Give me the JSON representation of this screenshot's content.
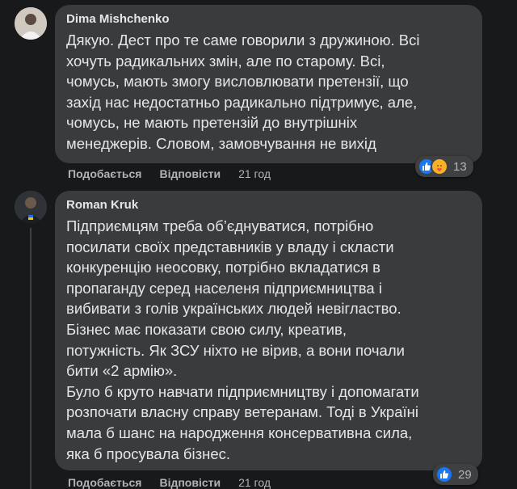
{
  "comments": [
    {
      "author": "Dima Mishchenko",
      "lines": [
        "Дякую. Дест про те саме говорили з дружиною. Всі",
        "хочуть радикальних змін, але по старому. Всі,",
        "чомусь, мають змогу висловлювати претензії, що",
        "захід нас недостатньо радикально підтримує, але,",
        "чомусь, не мають претензій до внутрішніх",
        "менеджерів. Словом, замовчування не вихід"
      ],
      "like_label": "Подобається",
      "reply_label": "Відповісти",
      "time": "21 год",
      "reaction_count": "13",
      "reactions": [
        "like-icon",
        "care-icon"
      ]
    },
    {
      "author": "Roman Kruk",
      "lines": [
        "Підприємцям треба об’єднуватися, потрібно",
        "посилати своїх представників у владу і скласти",
        "конкуренцію неосовку, потрібно вкладатися в",
        "пропаганду серед населеня підприємництва і",
        "вибивати з голів українських людей невігластво.",
        "Бізнес має показати свою силу, креатив,",
        "потужність. Як ЗСУ ніхто не вірив, а вони почали",
        "бити «2 армію».",
        "Було б круто навчати підприємництву і допомагати",
        "розпочати власну справу ветеранам. Тоді в Україні",
        "мала б шанс на народження консервативна сила,",
        "яка б просувала бізнес."
      ],
      "like_label": "Подобається",
      "reply_label": "Відповісти",
      "time": "21 год",
      "reaction_count": "29",
      "reactions": [
        "like-icon"
      ]
    }
  ],
  "colors": {
    "background": "#18191a",
    "bubble": "#3a3b3c",
    "text": "#e4e6eb",
    "secondary": "#b0b3b8",
    "like_blue": "#1877f2"
  }
}
